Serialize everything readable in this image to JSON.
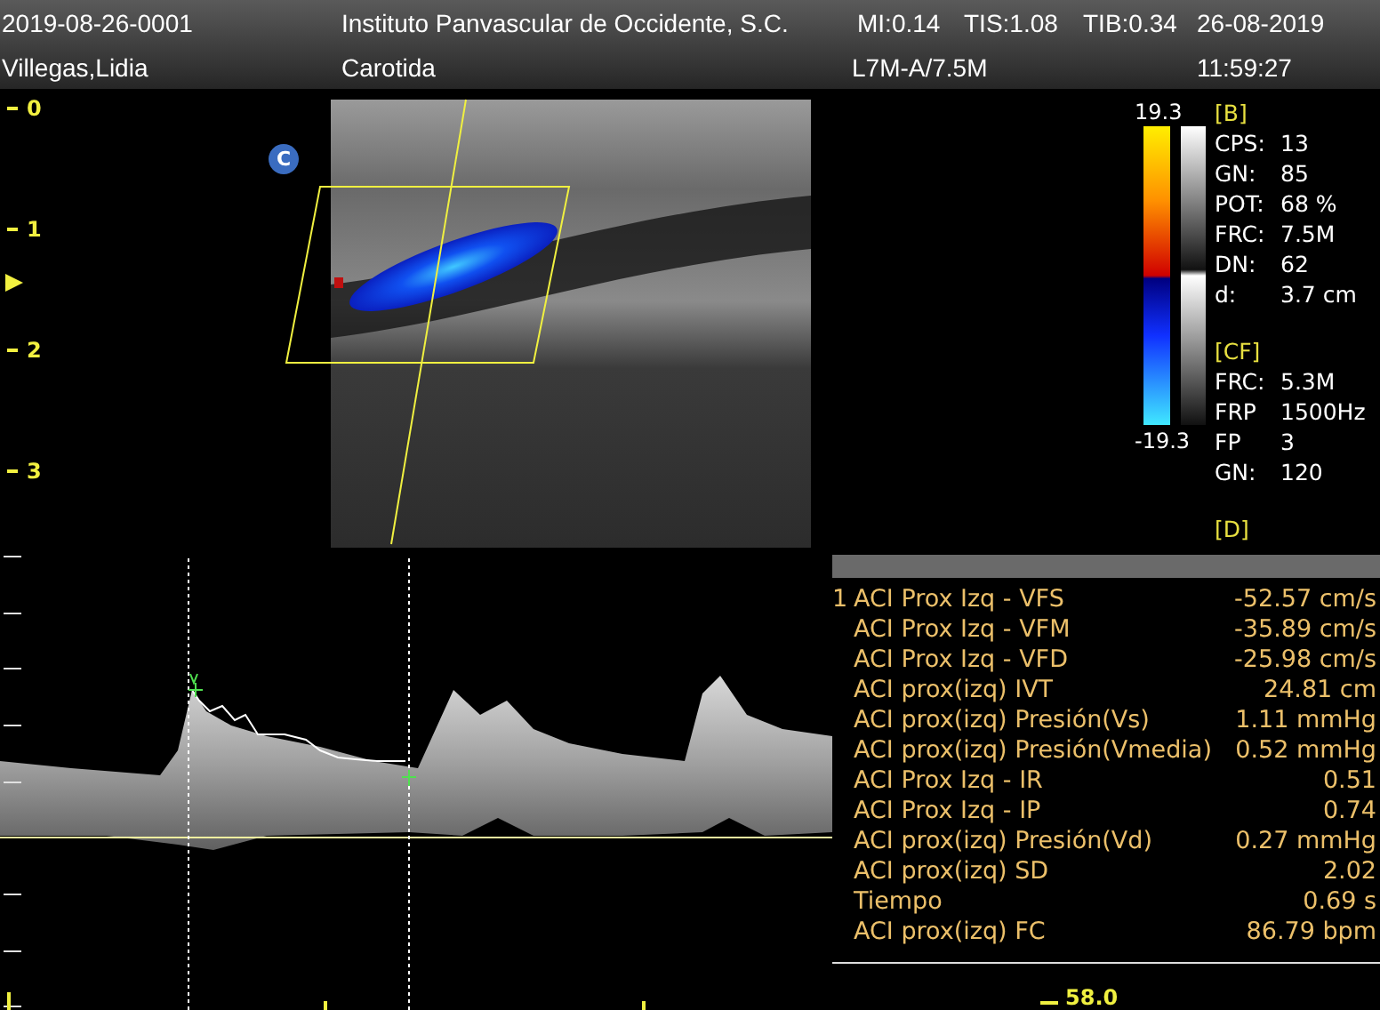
{
  "header": {
    "row1": [
      "2019-08-26-0001",
      "Instituto Panvascular de Occidente, S.C.",
      "MI:0.14",
      "TIS:1.08",
      "TIB:0.34",
      "26-08-2019"
    ],
    "row2": [
      "Villegas,Lidia",
      "Carotida",
      "L7M-A/7.5M",
      "11:59:27"
    ]
  },
  "depth_scale": [
    "0",
    "1",
    "2",
    "3"
  ],
  "mode_badge": "C",
  "color_bar": {
    "max": "19.3",
    "min": "-19.3"
  },
  "params": [
    {
      "title": "[B]",
      "rows": [
        {
          "label": "CPS:",
          "value": "13"
        },
        {
          "label": "GN:",
          "value": "85"
        },
        {
          "label": "POT:",
          "value": "68 %"
        },
        {
          "label": "FRC:",
          "value": "7.5M"
        },
        {
          "label": "DN:",
          "value": "62"
        },
        {
          "label": "d:",
          "value": "3.7 cm"
        }
      ]
    },
    {
      "title": "[CF]",
      "rows": [
        {
          "label": "FRC:",
          "value": "5.3M"
        },
        {
          "label": "FRP",
          "value": "1500Hz"
        },
        {
          "label": "FP",
          "value": "3"
        },
        {
          "label": "GN:",
          "value": "120"
        }
      ]
    },
    {
      "title": "[D]"
    }
  ],
  "measurements": [
    {
      "marker": "1",
      "label": "ACI Prox Izq - VFS",
      "value": "-52.57 cm/s"
    },
    {
      "label": "ACI Prox Izq - VFM",
      "value": "-35.89 cm/s"
    },
    {
      "label": "ACI Prox Izq - VFD",
      "value": "-25.98 cm/s"
    },
    {
      "label": "ACI prox(izq) IVT",
      "value": "24.81 cm"
    },
    {
      "label": "ACI prox(izq) Presión(Vs)",
      "value": "1.11 mmHg"
    },
    {
      "label": "ACI prox(izq) Presión(Vmedia)",
      "value": "0.52 mmHg"
    },
    {
      "label": "ACI Prox Izq - IR",
      "value": "0.51"
    },
    {
      "label": "ACI Prox Izq - IP",
      "value": "0.74"
    },
    {
      "label": "ACI prox(izq) Presión(Vd)",
      "value": "0.27 mmHg"
    },
    {
      "label": "ACI prox(izq) SD",
      "value": "2.02"
    },
    {
      "label": "Tiempo",
      "value": "0.69 s"
    },
    {
      "label": "ACI prox(izq) FC",
      "value": "86.79 bpm"
    }
  ],
  "sweep_speed": "58.0"
}
